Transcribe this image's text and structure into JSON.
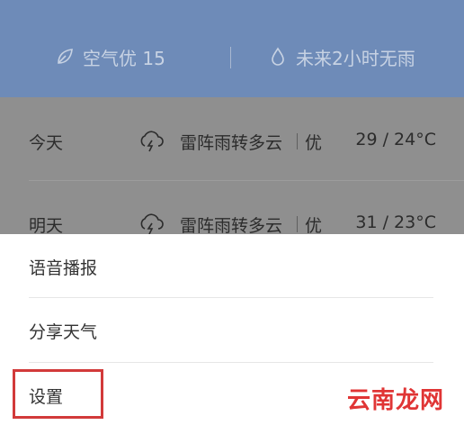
{
  "header": {
    "air_quality": "空气优 15",
    "rain_forecast": "未来2小时无雨"
  },
  "forecast": [
    {
      "day": "今天",
      "condition": "雷阵雨转多云",
      "aqi": "优",
      "temp": "29 / 24°C"
    },
    {
      "day": "明天",
      "condition": "雷阵雨转多云",
      "aqi": "优",
      "temp": "31 / 23°C"
    }
  ],
  "menu": {
    "items": [
      {
        "label": "语音播报"
      },
      {
        "label": "分享天气"
      },
      {
        "label": "设置"
      }
    ]
  },
  "watermark": "云南龙网",
  "colors": {
    "header_bg": "#6e8bb8",
    "overlay_bg": "#8f8f8f",
    "highlight": "#d23a3a"
  },
  "icons": {
    "air": "leaf-icon",
    "rain": "water-drop-icon",
    "weather": "thunder-cloud-icon"
  }
}
